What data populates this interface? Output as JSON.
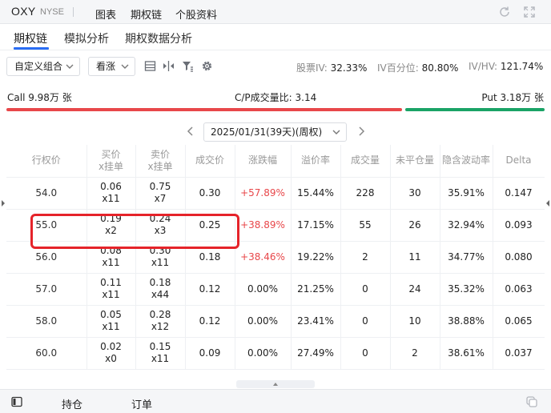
{
  "topbar": {
    "ticker": "OXY",
    "exchange": "NYSE",
    "tabs": [
      {
        "label": "图表"
      },
      {
        "label": "期权链"
      },
      {
        "label": "个股资料"
      }
    ]
  },
  "subtabs": [
    {
      "label": "期权链"
    },
    {
      "label": "模拟分析"
    },
    {
      "label": "期权数据分析"
    }
  ],
  "controls": {
    "strategy": "自定义组合",
    "direction": "看涨",
    "stats": {
      "iv_label": "股票IV:",
      "iv_value": "32.33%",
      "ivp_label": "IV百分位:",
      "ivp_value": "80.80%",
      "ivhv_label": "IV/HV:",
      "ivhv_value": "121.74%"
    }
  },
  "volume": {
    "call": "Call 9.98万 张",
    "ratio": "C/P成交量比: 3.14",
    "put": "Put 3.18万 张",
    "call_color": "#e8474a",
    "put_color": "#1aa366"
  },
  "expiry": {
    "selected": "2025/01/31(39天)(周权)"
  },
  "table": {
    "headers": {
      "strike": "行权价",
      "bid_1": "买价",
      "bid_2": "x挂单",
      "ask_1": "卖价",
      "ask_2": "x挂单",
      "last": "成交价",
      "change": "涨跌幅",
      "premium": "溢价率",
      "volume": "成交量",
      "oi": "未平仓量",
      "iv": "隐含波动率",
      "delta": "Delta"
    },
    "rows": [
      {
        "strike": "54.0",
        "bid": "0.06",
        "bid_size": "x11",
        "ask": "0.75",
        "ask_size": "x7",
        "last": "0.30",
        "change": "+57.89%",
        "premium": "15.44%",
        "volume": "228",
        "oi": "30",
        "iv": "35.91%",
        "delta": "0.147"
      },
      {
        "strike": "55.0",
        "bid": "0.19",
        "bid_size": "x2",
        "ask": "0.24",
        "ask_size": "x3",
        "last": "0.25",
        "change": "+38.89%",
        "premium": "17.15%",
        "volume": "55",
        "oi": "26",
        "iv": "32.94%",
        "delta": "0.093"
      },
      {
        "strike": "56.0",
        "bid": "0.08",
        "bid_size": "x11",
        "ask": "0.30",
        "ask_size": "x11",
        "last": "0.18",
        "change": "+38.46%",
        "premium": "19.22%",
        "volume": "2",
        "oi": "11",
        "iv": "34.77%",
        "delta": "0.080"
      },
      {
        "strike": "57.0",
        "bid": "0.11",
        "bid_size": "x11",
        "ask": "0.18",
        "ask_size": "x44",
        "last": "0.12",
        "change": "0.00%",
        "premium": "21.25%",
        "volume": "0",
        "oi": "24",
        "iv": "35.32%",
        "delta": "0.063"
      },
      {
        "strike": "58.0",
        "bid": "0.05",
        "bid_size": "x11",
        "ask": "0.28",
        "ask_size": "x12",
        "last": "0.12",
        "change": "0.00%",
        "premium": "23.41%",
        "volume": "0",
        "oi": "10",
        "iv": "38.88%",
        "delta": "0.065"
      },
      {
        "strike": "60.0",
        "bid": "0.02",
        "bid_size": "x0",
        "ask": "0.15",
        "ask_size": "x11",
        "last": "0.09",
        "change": "0.00%",
        "premium": "27.49%",
        "volume": "0",
        "oi": "2",
        "iv": "38.61%",
        "delta": "0.037"
      }
    ]
  },
  "bottombar": {
    "tabs": [
      {
        "label": "持仓"
      },
      {
        "label": "订单"
      }
    ]
  }
}
